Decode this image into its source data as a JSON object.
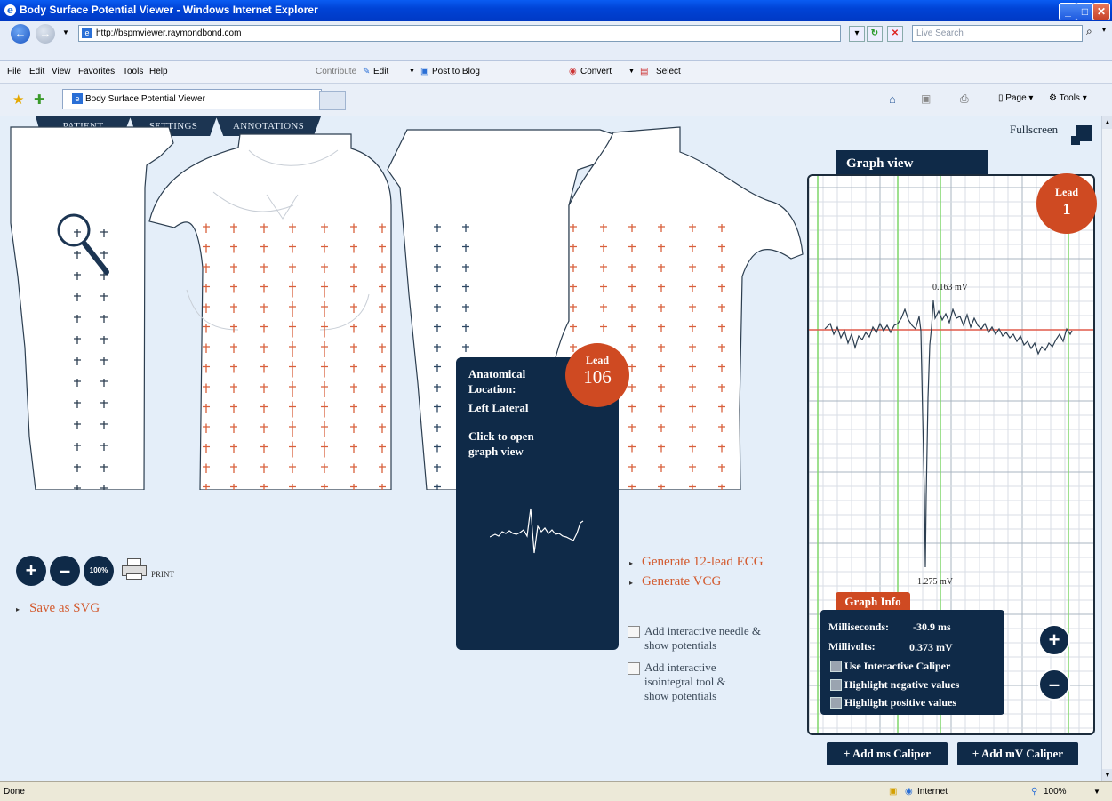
{
  "window": {
    "title": "Body Surface Potential Viewer - Windows Internet Explorer",
    "address": "http://bspmviewer.raymondbond.com",
    "search_placeholder": "Live Search",
    "tab_title": "Body Surface Potential Viewer"
  },
  "menu": {
    "items": [
      "File",
      "Edit",
      "View",
      "Favorites",
      "Tools",
      "Help"
    ],
    "contribute": "Contribute",
    "edit_btn": "Edit",
    "post_blog": "Post to Blog",
    "convert": "Convert",
    "select": "Select"
  },
  "command_bar": {
    "page": "Page",
    "tools": "Tools"
  },
  "app": {
    "tabs": [
      "PATIENT",
      "SETTINGS",
      "ANNOTATIONS"
    ],
    "fullscreen": "Fullscreen",
    "graph_view_title": "Graph view",
    "graph_lead_label": "Lead",
    "graph_lead_number": "1",
    "peak_label": "0.163  mV",
    "trough_label": "1.275  mV",
    "graph_info_title": "Graph Info",
    "info": {
      "ms_label": "Milliseconds:",
      "ms_value": "-30.9 ms",
      "mv_label": "Millivolts:",
      "mv_value": "0.373 mV",
      "opt1": "Use Interactive Caliper",
      "opt2": "Highlight negative values",
      "opt3": "Highlight positive values"
    },
    "tooltip": {
      "lead_label": "Lead",
      "lead_number": "106",
      "anat_label": "Anatomical Location:",
      "location": "Left Lateral",
      "hint": "Click to open graph view"
    },
    "zoom": {
      "plus": "+",
      "minus": "–",
      "reset": "100%",
      "print": "PRINT"
    },
    "links": {
      "save_svg": "Save as SVG",
      "gen_ecg": "Generate 12-lead ECG",
      "gen_vcg": "Generate VCG"
    },
    "options": {
      "needle": "Add interactive needle & show potentials",
      "isointegral": "Add interactive isointegral tool & show potentials"
    },
    "calipers": {
      "ms": "+ Add ms Caliper",
      "mv": "+ Add mV Caliper"
    },
    "graph_zoom": {
      "plus": "+",
      "minus": "–"
    }
  },
  "status": {
    "left": "Done",
    "zone": "Internet",
    "zoom": "100%"
  },
  "colors": {
    "navy": "#0f2a48",
    "orange": "#cf4a22",
    "electrode_red": "#d8603c",
    "electrode_blue": "#2c4662",
    "grid_green": "#7fd66a",
    "baseline_red": "#e05a4a"
  }
}
